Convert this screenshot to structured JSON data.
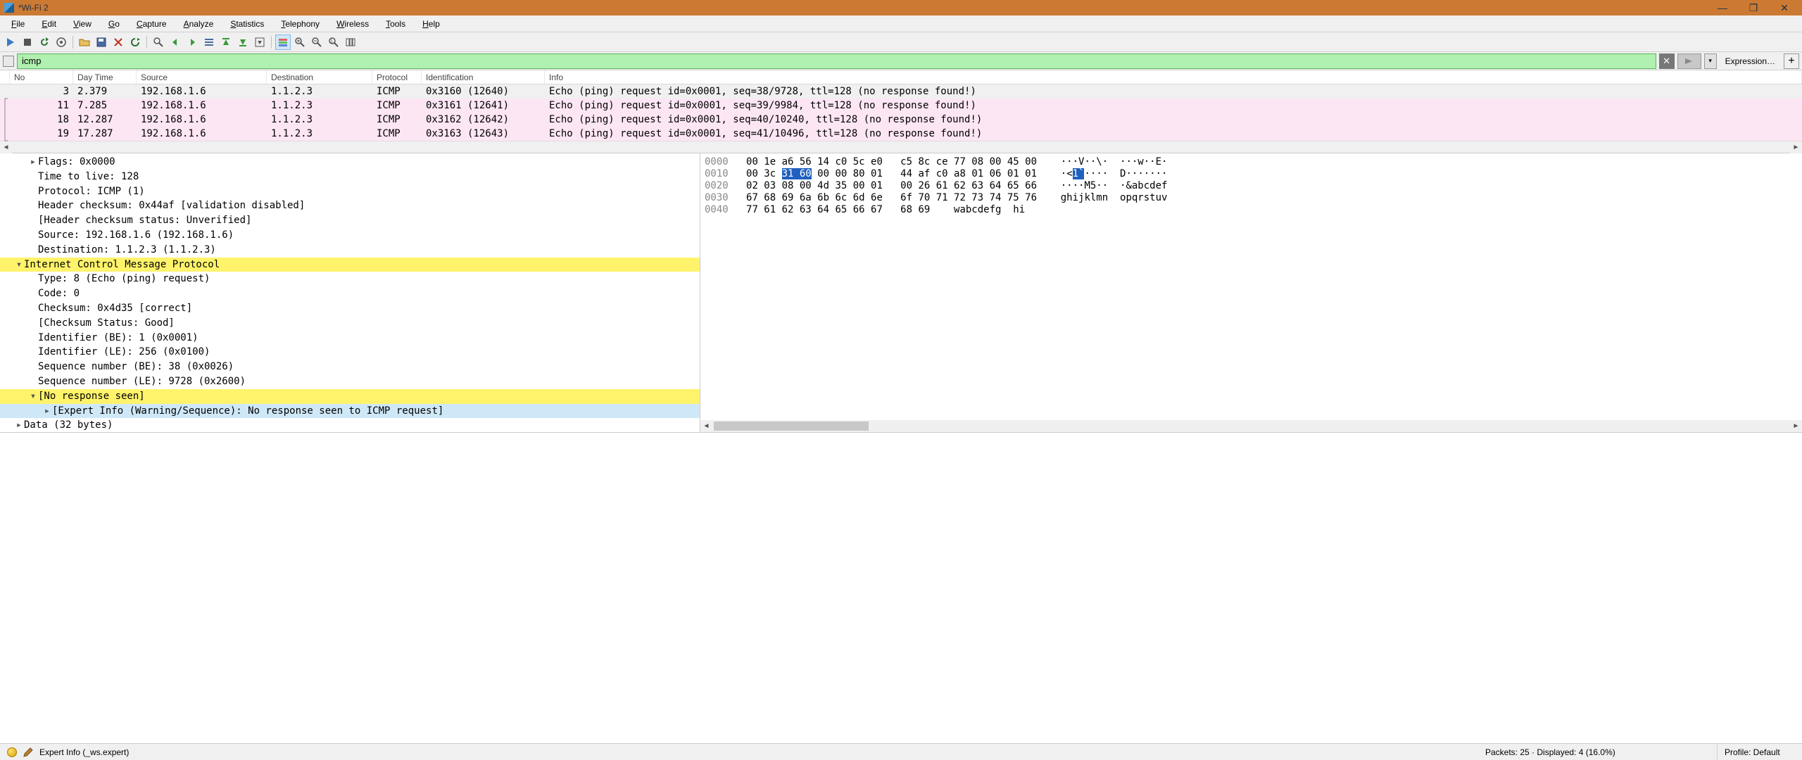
{
  "window": {
    "title": "*Wi-Fi 2"
  },
  "menu": {
    "items": [
      "File",
      "Edit",
      "View",
      "Go",
      "Capture",
      "Analyze",
      "Statistics",
      "Telephony",
      "Wireless",
      "Tools",
      "Help"
    ]
  },
  "filter": {
    "value": "icmp",
    "expression_label": "Expression…"
  },
  "columns": [
    "No",
    "Day Time",
    "Source",
    "Destination",
    "Protocol",
    "Identification",
    "Info"
  ],
  "packets": [
    {
      "no": "3",
      "time": "2.379",
      "src": "192.168.1.6",
      "dst": "1.1.2.3",
      "proto": "ICMP",
      "id": "0x3160 (12640)",
      "info": "Echo (ping) request  id=0x0001, seq=38/9728, ttl=128 (no response found!)",
      "style": "sel"
    },
    {
      "no": "11",
      "time": "7.285",
      "src": "192.168.1.6",
      "dst": "1.1.2.3",
      "proto": "ICMP",
      "id": "0x3161 (12641)",
      "info": "Echo (ping) request  id=0x0001, seq=39/9984, ttl=128 (no response found!)",
      "style": "pink"
    },
    {
      "no": "18",
      "time": "12.287",
      "src": "192.168.1.6",
      "dst": "1.1.2.3",
      "proto": "ICMP",
      "id": "0x3162 (12642)",
      "info": "Echo (ping) request  id=0x0001, seq=40/10240, ttl=128 (no response found!)",
      "style": "pink"
    },
    {
      "no": "19",
      "time": "17.287",
      "src": "192.168.1.6",
      "dst": "1.1.2.3",
      "proto": "ICMP",
      "id": "0x3163 (12643)",
      "info": "Echo (ping) request  id=0x0001, seq=41/10496, ttl=128 (no response found!)",
      "style": "pink"
    }
  ],
  "tree": [
    {
      "indent": 1,
      "toggle": ">",
      "text": "Flags: 0x0000"
    },
    {
      "indent": 1,
      "toggle": "",
      "text": "Time to live: 128"
    },
    {
      "indent": 1,
      "toggle": "",
      "text": "Protocol: ICMP (1)"
    },
    {
      "indent": 1,
      "toggle": "",
      "text": "Header checksum: 0x44af [validation disabled]"
    },
    {
      "indent": 1,
      "toggle": "",
      "text": "[Header checksum status: Unverified]"
    },
    {
      "indent": 1,
      "toggle": "",
      "text": "Source: 192.168.1.6 (192.168.1.6)"
    },
    {
      "indent": 1,
      "toggle": "",
      "text": "Destination: 1.1.2.3 (1.1.2.3)"
    },
    {
      "indent": 0,
      "toggle": "v",
      "text": "Internet Control Message Protocol",
      "hl": "yellow"
    },
    {
      "indent": 1,
      "toggle": "",
      "text": "Type: 8 (Echo (ping) request)"
    },
    {
      "indent": 1,
      "toggle": "",
      "text": "Code: 0"
    },
    {
      "indent": 1,
      "toggle": "",
      "text": "Checksum: 0x4d35 [correct]"
    },
    {
      "indent": 1,
      "toggle": "",
      "text": "[Checksum Status: Good]"
    },
    {
      "indent": 1,
      "toggle": "",
      "text": "Identifier (BE): 1 (0x0001)"
    },
    {
      "indent": 1,
      "toggle": "",
      "text": "Identifier (LE): 256 (0x0100)"
    },
    {
      "indent": 1,
      "toggle": "",
      "text": "Sequence number (BE): 38 (0x0026)"
    },
    {
      "indent": 1,
      "toggle": "",
      "text": "Sequence number (LE): 9728 (0x2600)"
    },
    {
      "indent": 1,
      "toggle": "v",
      "text": "[No response seen]",
      "hl": "yellow"
    },
    {
      "indent": 2,
      "toggle": ">",
      "text": "[Expert Info (Warning/Sequence): No response seen to ICMP request]",
      "hl": "blue"
    },
    {
      "indent": 0,
      "toggle": ">",
      "text": "Data (32 bytes)"
    }
  ],
  "hex": {
    "rows": [
      {
        "off": "0000",
        "b1": "00 1e a6 56 14 c0 5c e0",
        "b2": "c5 8c ce 77 08 00 45 00",
        "a": "···V··\\·  ···w··E·"
      },
      {
        "off": "0010",
        "b1_pre": "00 3c ",
        "b1_sel": "31 60",
        "b1_post": " 00 00 80 01",
        "b2": "44 af c0 a8 01 06 01 01",
        "a_pre": "·<",
        "a_sel": "1`",
        "a_post": "····  D·······"
      },
      {
        "off": "0020",
        "b1": "02 03 08 00 4d 35 00 01",
        "b2": "00 26 61 62 63 64 65 66",
        "a": "····M5··  ·&abcdef"
      },
      {
        "off": "0030",
        "b1": "67 68 69 6a 6b 6c 6d 6e",
        "b2": "6f 70 71 72 73 74 75 76",
        "a": "ghijklmn  opqrstuv"
      },
      {
        "off": "0040",
        "b1": "77 61 62 63 64 65 66 67",
        "b2": "68 69",
        "a": "wabcdefg  hi"
      }
    ]
  },
  "status": {
    "hint": "Expert Info (_ws.expert)",
    "packets": "Packets: 25 · Displayed: 4 (16.0%)",
    "profile": "Profile: Default"
  }
}
